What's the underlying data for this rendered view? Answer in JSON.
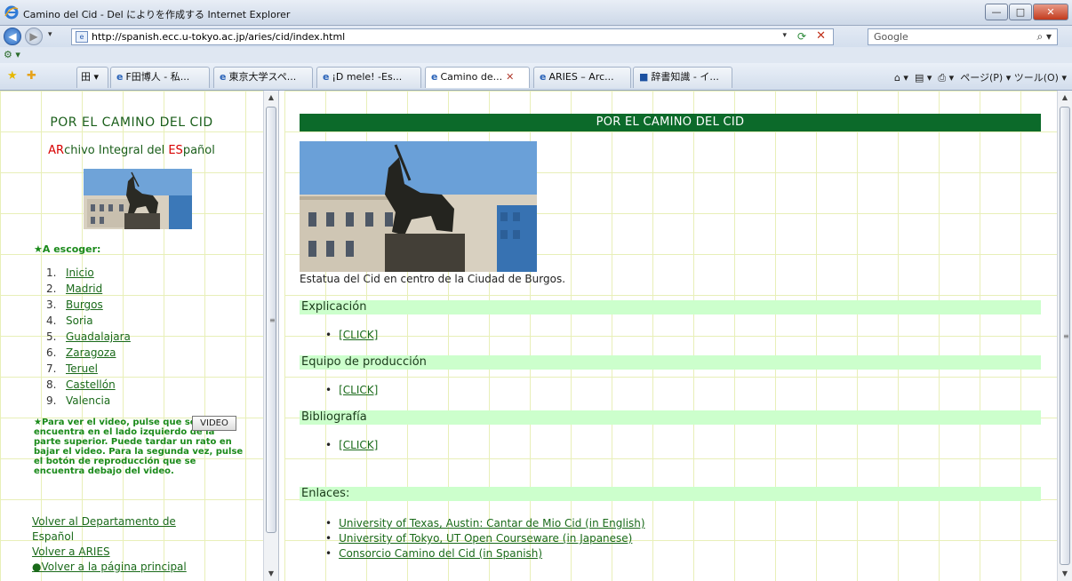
{
  "window": {
    "title": "Camino del Cid - Del によりを作成する Internet Explorer",
    "buttons": {
      "minimize": "—",
      "maximize": "□",
      "close": "✕"
    }
  },
  "address_bar": {
    "url": "http://spanish.ecc.u-tokyo.ac.jp/aries/cid/index.html",
    "search_placeholder": "Google"
  },
  "tabs": [
    {
      "label": "田 ▾",
      "active": false
    },
    {
      "label": "F田博人 - 私...",
      "active": false
    },
    {
      "label": "東京大学スペ...",
      "active": false
    },
    {
      "label": "¡D mele! -Es...",
      "active": false
    },
    {
      "label": "Camino de...",
      "active": true
    },
    {
      "label": "ARIES – Arc...",
      "active": false
    },
    {
      "label": "辞書知識 - イ...",
      "active": false
    }
  ],
  "command_bar": "ページ(P) ▾   ツール(O) ▾",
  "left_frame": {
    "title": "POR EL CAMINO DEL CID",
    "subtitle_parts": [
      {
        "text": "AR",
        "red": true
      },
      {
        "text": "chivo Integral del ",
        "red": false
      },
      {
        "text": "ES",
        "red": true
      },
      {
        "text": "pañol",
        "red": false
      }
    ],
    "choose_label": "★A escoger:",
    "menu": [
      {
        "num": "1.",
        "label": "Inicio",
        "link": true
      },
      {
        "num": "2.",
        "label": "Madrid",
        "link": true
      },
      {
        "num": "3.",
        "label": "Burgos",
        "link": true
      },
      {
        "num": "4.",
        "label": "Soria",
        "link": false
      },
      {
        "num": "5.",
        "label": "Guadalajara",
        "link": true
      },
      {
        "num": "6.",
        "label": "Zaragoza",
        "link": true
      },
      {
        "num": "7.",
        "label": "Teruel",
        "link": true
      },
      {
        "num": "8.",
        "label": "Castellón",
        "link": true
      },
      {
        "num": "9.",
        "label": "Valencia",
        "link": false
      }
    ],
    "video_text": "★Para ver el video, pulse                 que se encuentra en el lado izquierdo de la parte superior. Puede tardar un rato en bajar el video. Para la segunda vez, pulse el botón de reproducción que se encuentra debajo del video.",
    "video_button": "VIDEO",
    "footer_links": {
      "dept_link": "Volver al Departamento de",
      "dept_text": "Español",
      "aries": "Volver a ARIES",
      "home": "●Volver a la página principal"
    }
  },
  "right_frame": {
    "banner": "POR EL CAMINO DEL CID",
    "caption": "Estatua del Cid en centro de la Ciudad de Burgos.",
    "sections": [
      {
        "title": "Explicación",
        "item": "[CLICK]"
      },
      {
        "title": "Equipo de producción",
        "item": "[CLICK]"
      },
      {
        "title": "Bibliografía",
        "item": "[CLICK]"
      }
    ],
    "links_title": "Enlaces:",
    "links": [
      "University of Texas, Austin: Cantar de Mio Cid (in English)",
      "University of Tokyo, UT Open Courseware (in Japanese)",
      "Consorcio Camino del Cid (in Spanish)"
    ]
  }
}
